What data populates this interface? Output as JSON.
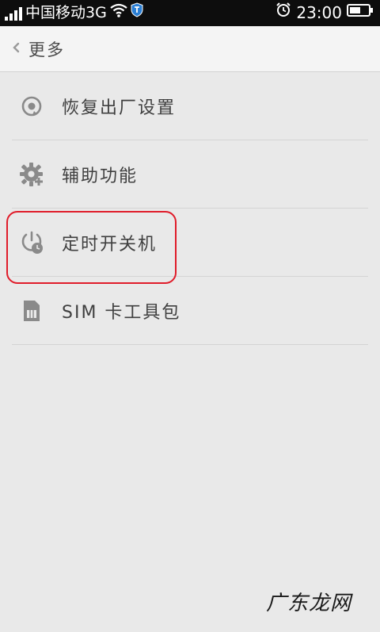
{
  "status_bar": {
    "carrier": "中国移动3G",
    "time": "23:00",
    "icons": [
      "signal-icon",
      "wifi-icon",
      "shield-icon",
      "alarm-icon",
      "battery-icon"
    ]
  },
  "header": {
    "back_icon": "chevron-left-icon",
    "title": "更多"
  },
  "menu": {
    "items": [
      {
        "label": "恢复出厂设置",
        "icon": "factory-reset-icon"
      },
      {
        "label": "辅助功能",
        "icon": "accessibility-gear-icon"
      },
      {
        "label": "定时开关机",
        "icon": "scheduled-power-icon"
      },
      {
        "label": "SIM 卡工具包",
        "icon": "sim-card-icon"
      }
    ]
  },
  "annotation": {
    "highlight_color": "#e01c2a"
  },
  "watermark": {
    "text": "广东龙网"
  },
  "colors": {
    "status_bar_bg": "#0d0d0d",
    "header_bg": "#f4f4f4",
    "page_bg": "#e9e9e9",
    "text": "#3f3f3f",
    "icon": "#808080"
  }
}
